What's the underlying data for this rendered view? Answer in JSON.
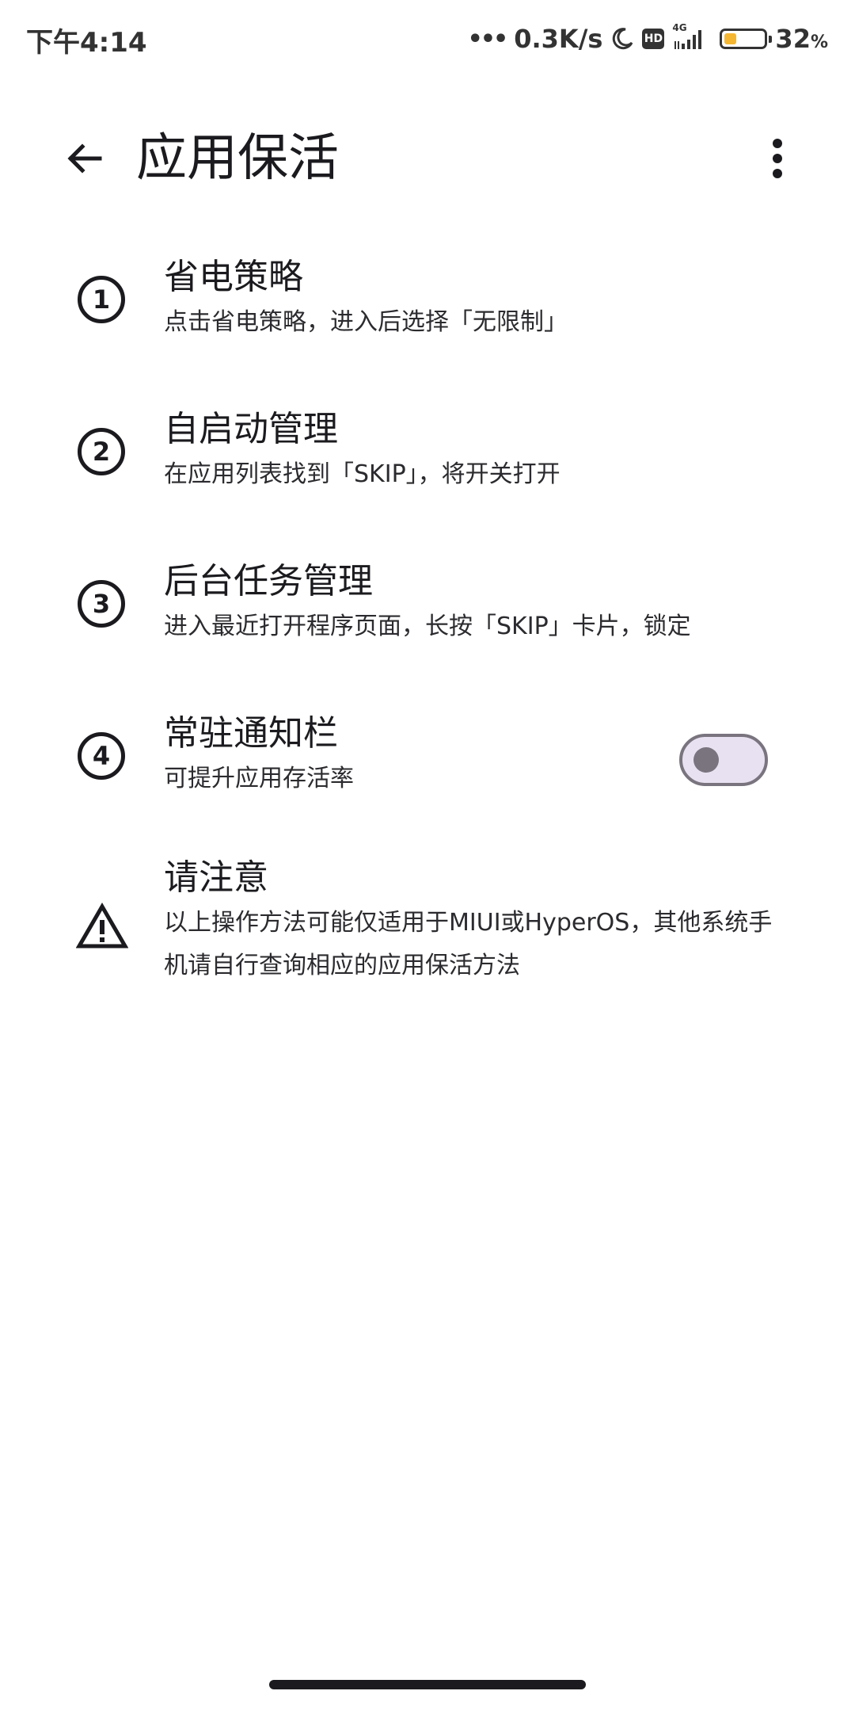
{
  "status_bar": {
    "time": "下午4:14",
    "network_speed": "0.3K/s",
    "hd_badge": "HD",
    "signal_label": "4G",
    "battery_percent_value": "32",
    "battery_percent_sign": "%",
    "battery_level": 0.32,
    "battery_color": "#f5b731"
  },
  "app_bar": {
    "title": "应用保活",
    "back_icon": "arrow-back-icon",
    "more_icon": "more-vert-icon"
  },
  "items": [
    {
      "badge": "1",
      "title": "省电策略",
      "subtitle": "点击省电策略，进入后选择「无限制」"
    },
    {
      "badge": "2",
      "title": "自启动管理",
      "subtitle": "在应用列表找到「SKIP」，将开关打开"
    },
    {
      "badge": "3",
      "title": "后台任务管理",
      "subtitle": "进入最近打开程序页面，长按「SKIP」卡片，锁定"
    },
    {
      "badge": "4",
      "title": "常驻通知栏",
      "subtitle": "可提升应用存活率",
      "toggle_on": false
    }
  ],
  "notice": {
    "title": "请注意",
    "body": "以上操作方法可能仅适用于MIUI或HyperOS，其他系统手机请自行查询相应的应用保活方法",
    "icon": "warning-icon"
  },
  "colors": {
    "toggle_track": "#e8e1f1",
    "toggle_outline": "#79747e"
  }
}
